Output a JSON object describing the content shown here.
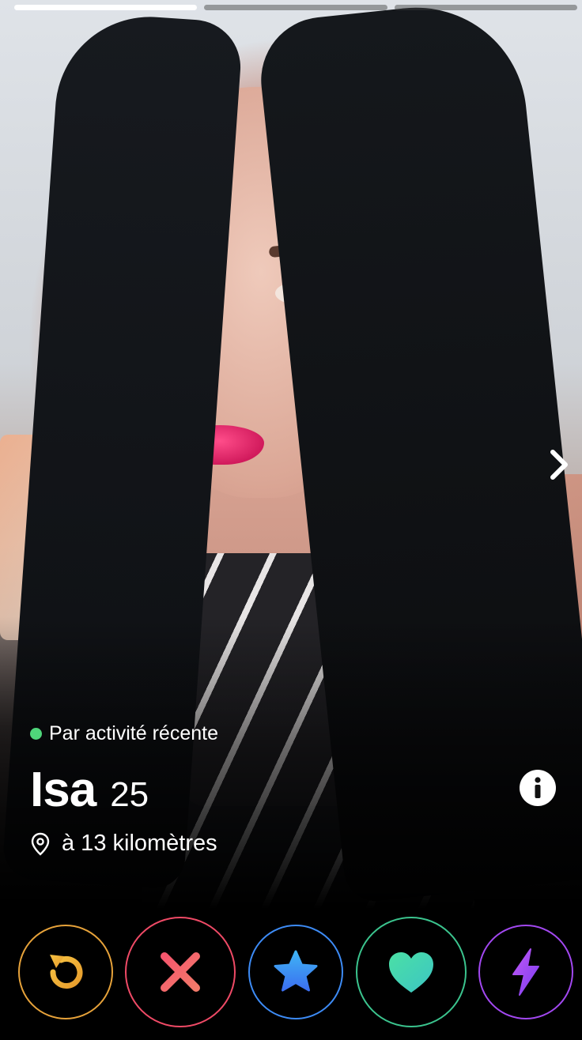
{
  "profile": {
    "activity_label": "Par activité récente",
    "name": "Isa",
    "age": "25",
    "distance": "à 13 kilomètres"
  },
  "photo_progress": {
    "total": 3,
    "current": 1
  },
  "icons": {
    "next": "chevron-right-icon",
    "info": "info-icon",
    "location": "location-pin-icon"
  },
  "actions": [
    {
      "name": "rewind",
      "icon": "rewind-icon",
      "color": "#e6a23a"
    },
    {
      "name": "nope",
      "icon": "x-icon",
      "color": "#ef4a66"
    },
    {
      "name": "super-like",
      "icon": "star-icon",
      "color": "#3d8bf5"
    },
    {
      "name": "like",
      "icon": "heart-icon",
      "color": "#3bc48e"
    },
    {
      "name": "boost",
      "icon": "lightning-icon",
      "color": "#a248f0"
    }
  ],
  "colors": {
    "online_dot": "#4fd67a"
  }
}
